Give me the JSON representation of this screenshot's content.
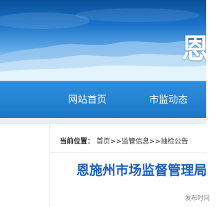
{
  "banner": {
    "title": "恩"
  },
  "nav": {
    "items": [
      {
        "label": "网站首页"
      },
      {
        "label": "市监动态"
      }
    ]
  },
  "breadcrumb": {
    "label": "当前位置：",
    "items": [
      "首页",
      "监管信息",
      "抽检公告"
    ],
    "separator": ">>"
  },
  "article": {
    "title": "恩施州市场监督管理局",
    "meta": "发布时间"
  },
  "colors": {
    "nav_bg": "#1b77c9",
    "title_blue": "#1d5fb5",
    "banner_sky": "#5fa7e6"
  }
}
